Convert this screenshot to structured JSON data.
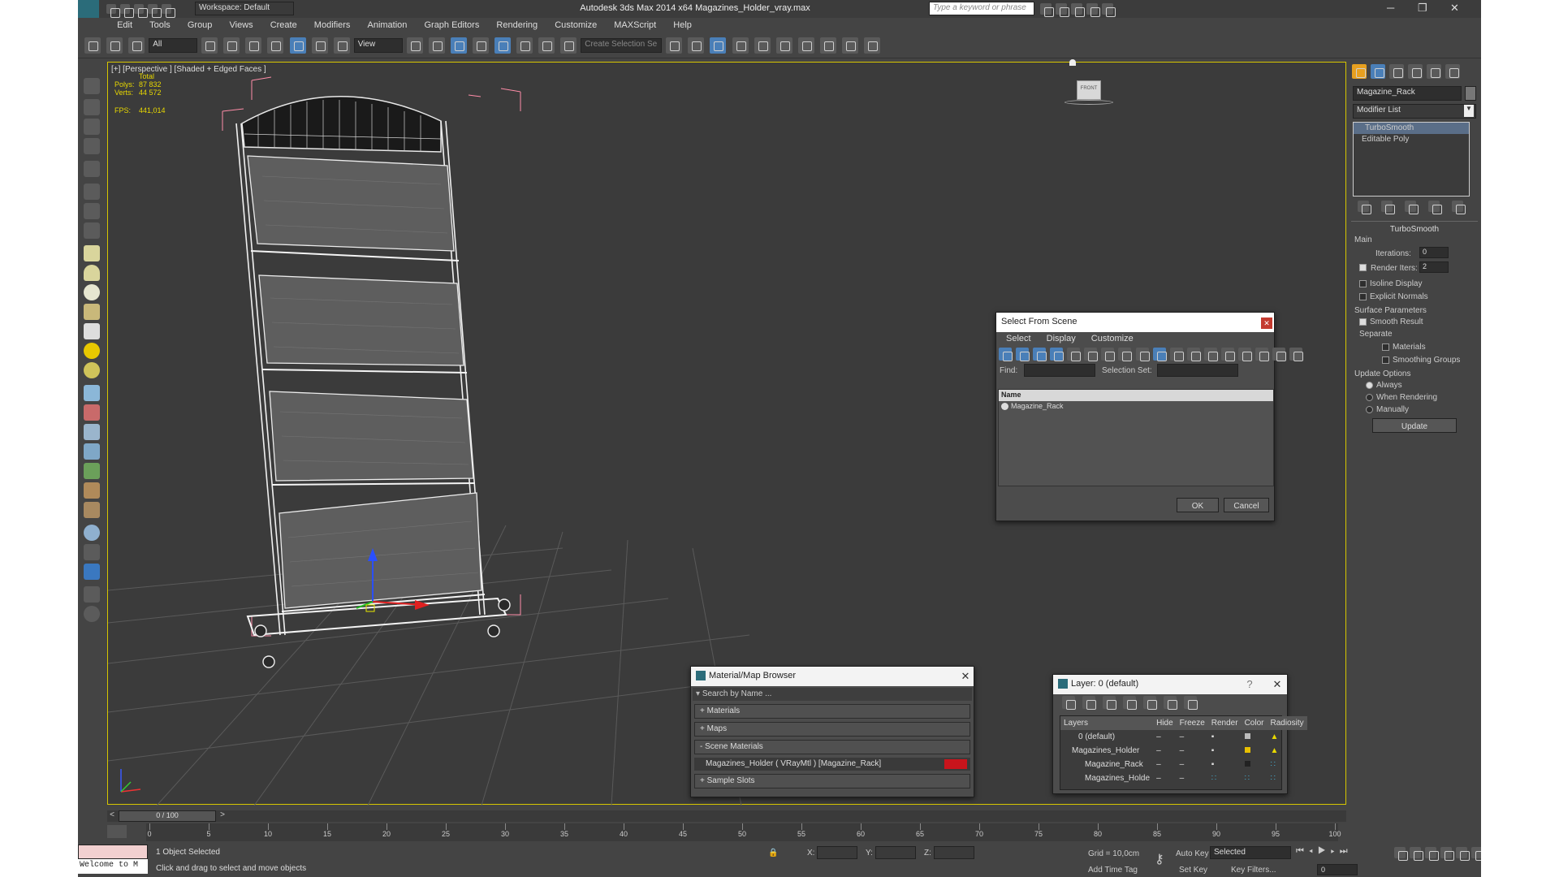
{
  "titlebar": {
    "workspace": "Workspace: Default",
    "title": "Autodesk 3ds Max  2014 x64    Magazines_Holder_vray.max",
    "search_placeholder": "Type a keyword or phrase"
  },
  "menu": [
    "Edit",
    "Tools",
    "Group",
    "Views",
    "Create",
    "Modifiers",
    "Animation",
    "Graph Editors",
    "Rendering",
    "Customize",
    "MAXScript",
    "Help"
  ],
  "toolbar": {
    "filter": "All",
    "ref_coord": "View",
    "selection_set": "Create Selection Se"
  },
  "viewport": {
    "label": "[+] [Perspective ] [Shaded + Edged Faces ]",
    "stats": {
      "total": "Total",
      "polys_label": "Polys:",
      "polys": "87 832",
      "verts_label": "Verts:",
      "verts": "44 572",
      "fps_label": "FPS:",
      "fps": "441,014"
    }
  },
  "command_panel": {
    "object_name": "Magazine_Rack",
    "modifier_list": "Modifier List",
    "stack": [
      "TurboSmooth",
      "Editable Poly"
    ],
    "rollout": {
      "title": "TurboSmooth",
      "main": "Main",
      "iterations_label": "Iterations:",
      "iterations": "0",
      "render_iters_label": "Render Iters:",
      "render_iters": "2",
      "isoline": "Isoline Display",
      "explicit": "Explicit Normals",
      "surface": "Surface Parameters",
      "smooth_result": "Smooth Result",
      "separate": "Separate",
      "materials": "Materials",
      "smoothing": "Smoothing Groups",
      "update_options": "Update Options",
      "always": "Always",
      "when_rendering": "When Rendering",
      "manually": "Manually",
      "update": "Update"
    }
  },
  "select_dialog": {
    "title": "Select From Scene",
    "menu": [
      "Select",
      "Display",
      "Customize"
    ],
    "find_label": "Find:",
    "selset_label": "Selection Set:",
    "col_name": "Name",
    "items": [
      "Magazine_Rack"
    ],
    "ok": "OK",
    "cancel": "Cancel"
  },
  "material_browser": {
    "title": "Material/Map Browser",
    "search": "Search by Name ...",
    "sections": [
      "+ Materials",
      "+ Maps",
      "- Scene Materials"
    ],
    "scene_item": "Magazines_Holder  ( VRayMtl )  [Magazine_Rack]",
    "sample": "+ Sample Slots",
    "swatch": "#c8141c"
  },
  "layer_dialog": {
    "title": "Layer: 0 (default)",
    "cols": [
      "Layers",
      "Hide",
      "Freeze",
      "Render",
      "Color",
      "Radiosity"
    ],
    "rows": [
      "0 (default)",
      "Magazines_Holder",
      "Magazine_Rack",
      "Magazines_Holde"
    ]
  },
  "timeline": {
    "slider": "0 / 100",
    "ticks": [
      "0",
      "5",
      "10",
      "15",
      "20",
      "25",
      "30",
      "35",
      "40",
      "45",
      "50",
      "55",
      "60",
      "65",
      "70",
      "75",
      "80",
      "85",
      "90",
      "95",
      "100"
    ]
  },
  "status": {
    "welcome": "Welcome to M",
    "selected": "1 Object Selected",
    "prompt": "Click and drag to select and move objects",
    "x": "X:",
    "y": "Y:",
    "z": "Z:",
    "grid": "Grid = 10,0cm",
    "add_time_tag": "Add Time Tag",
    "auto_key": "Auto Key",
    "set_key": "Set Key",
    "selected_dd": "Selected",
    "key_filters": "Key Filters...",
    "frame": "0"
  }
}
